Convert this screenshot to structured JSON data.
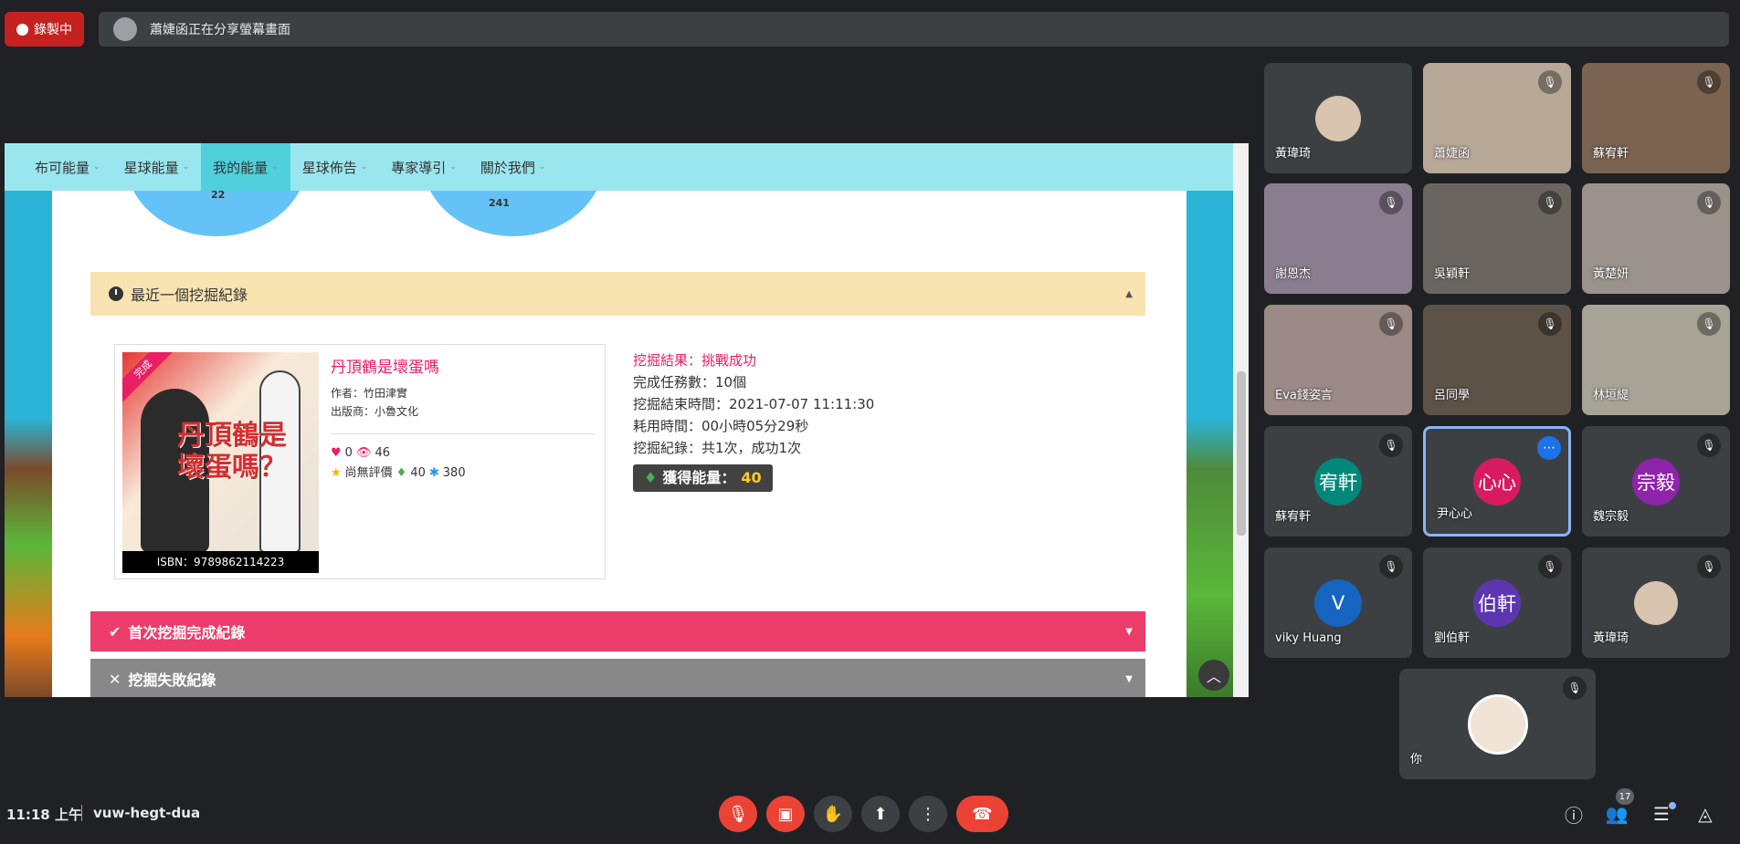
{
  "recording": {
    "label": "錄製中"
  },
  "share_banner": {
    "text": "蕭婕函正在分享螢幕畫面"
  },
  "site": {
    "nav": [
      "布可能量",
      "星球能量",
      "我的能量",
      "星球佈告",
      "專家導引",
      "關於我們"
    ],
    "circles": [
      "22",
      "241"
    ],
    "recent_panel": {
      "title": "最近一個挖掘紀錄"
    },
    "book": {
      "corner": "完成",
      "cover_title": "丹頂鶴是壞蛋嗎？",
      "isbn": "ISBN：9789862114223",
      "title": "丹頂鶴是壞蛋嗎",
      "author": "作者：竹田津實",
      "publisher": "出版商：小魯文化",
      "likes": "0",
      "views": "46",
      "rating": "尚無評價",
      "leaf_value": "40",
      "snow_value": "380"
    },
    "result": {
      "title": "挖掘結果：挑戰成功",
      "tasks": "完成任務數：10個",
      "end_time": "挖掘結束時間：2021-07-07 11:11:30",
      "duration": "耗用時間：00小時05分29秒",
      "record": "挖掘紀錄：共1次，成功1次",
      "energy_label": "獲得能量：",
      "energy_value": "40"
    },
    "first_panel": {
      "title": "首次挖掘完成紀錄"
    },
    "fail_panel": {
      "title": "挖掘失敗紀錄"
    }
  },
  "participants": [
    {
      "name": "黃瑋琦",
      "type": "photo-avatar"
    },
    {
      "name": "蕭婕函",
      "type": "video"
    },
    {
      "name": "蘇宥軒",
      "type": "video"
    },
    {
      "name": "謝恩杰",
      "type": "video"
    },
    {
      "name": "吳穎軒",
      "type": "video"
    },
    {
      "name": "黃楚妍",
      "type": "video"
    },
    {
      "name": "Eva錢姿言",
      "type": "video"
    },
    {
      "name": "呂同學",
      "type": "video"
    },
    {
      "name": "林垣緹",
      "type": "video"
    },
    {
      "name": "蘇宥軒",
      "initials": "宥軒",
      "color": "#00897b"
    },
    {
      "name": "尹心心",
      "initials": "心心",
      "color": "#d81b60"
    },
    {
      "name": "魏宗毅",
      "initials": "宗毅",
      "color": "#8e24aa"
    },
    {
      "name": "viky Huang",
      "initials": "V",
      "color": "#1565c0"
    },
    {
      "name": "劉伯軒",
      "initials": "伯軒",
      "color": "#5e35b1"
    },
    {
      "name": "黃瑋琦",
      "type": "photo-avatar"
    },
    {
      "name": "你",
      "type": "photo-avatar-large"
    }
  ],
  "bottom": {
    "time": "11:18 上午",
    "meeting_code": "vuw-hegt-dua",
    "people_count": "17"
  },
  "colors": {
    "nav_bg": "#9ae6ef",
    "accent_pink": "#ec3c6a",
    "meet_bg": "#202124",
    "end_call": "#ea4335"
  }
}
